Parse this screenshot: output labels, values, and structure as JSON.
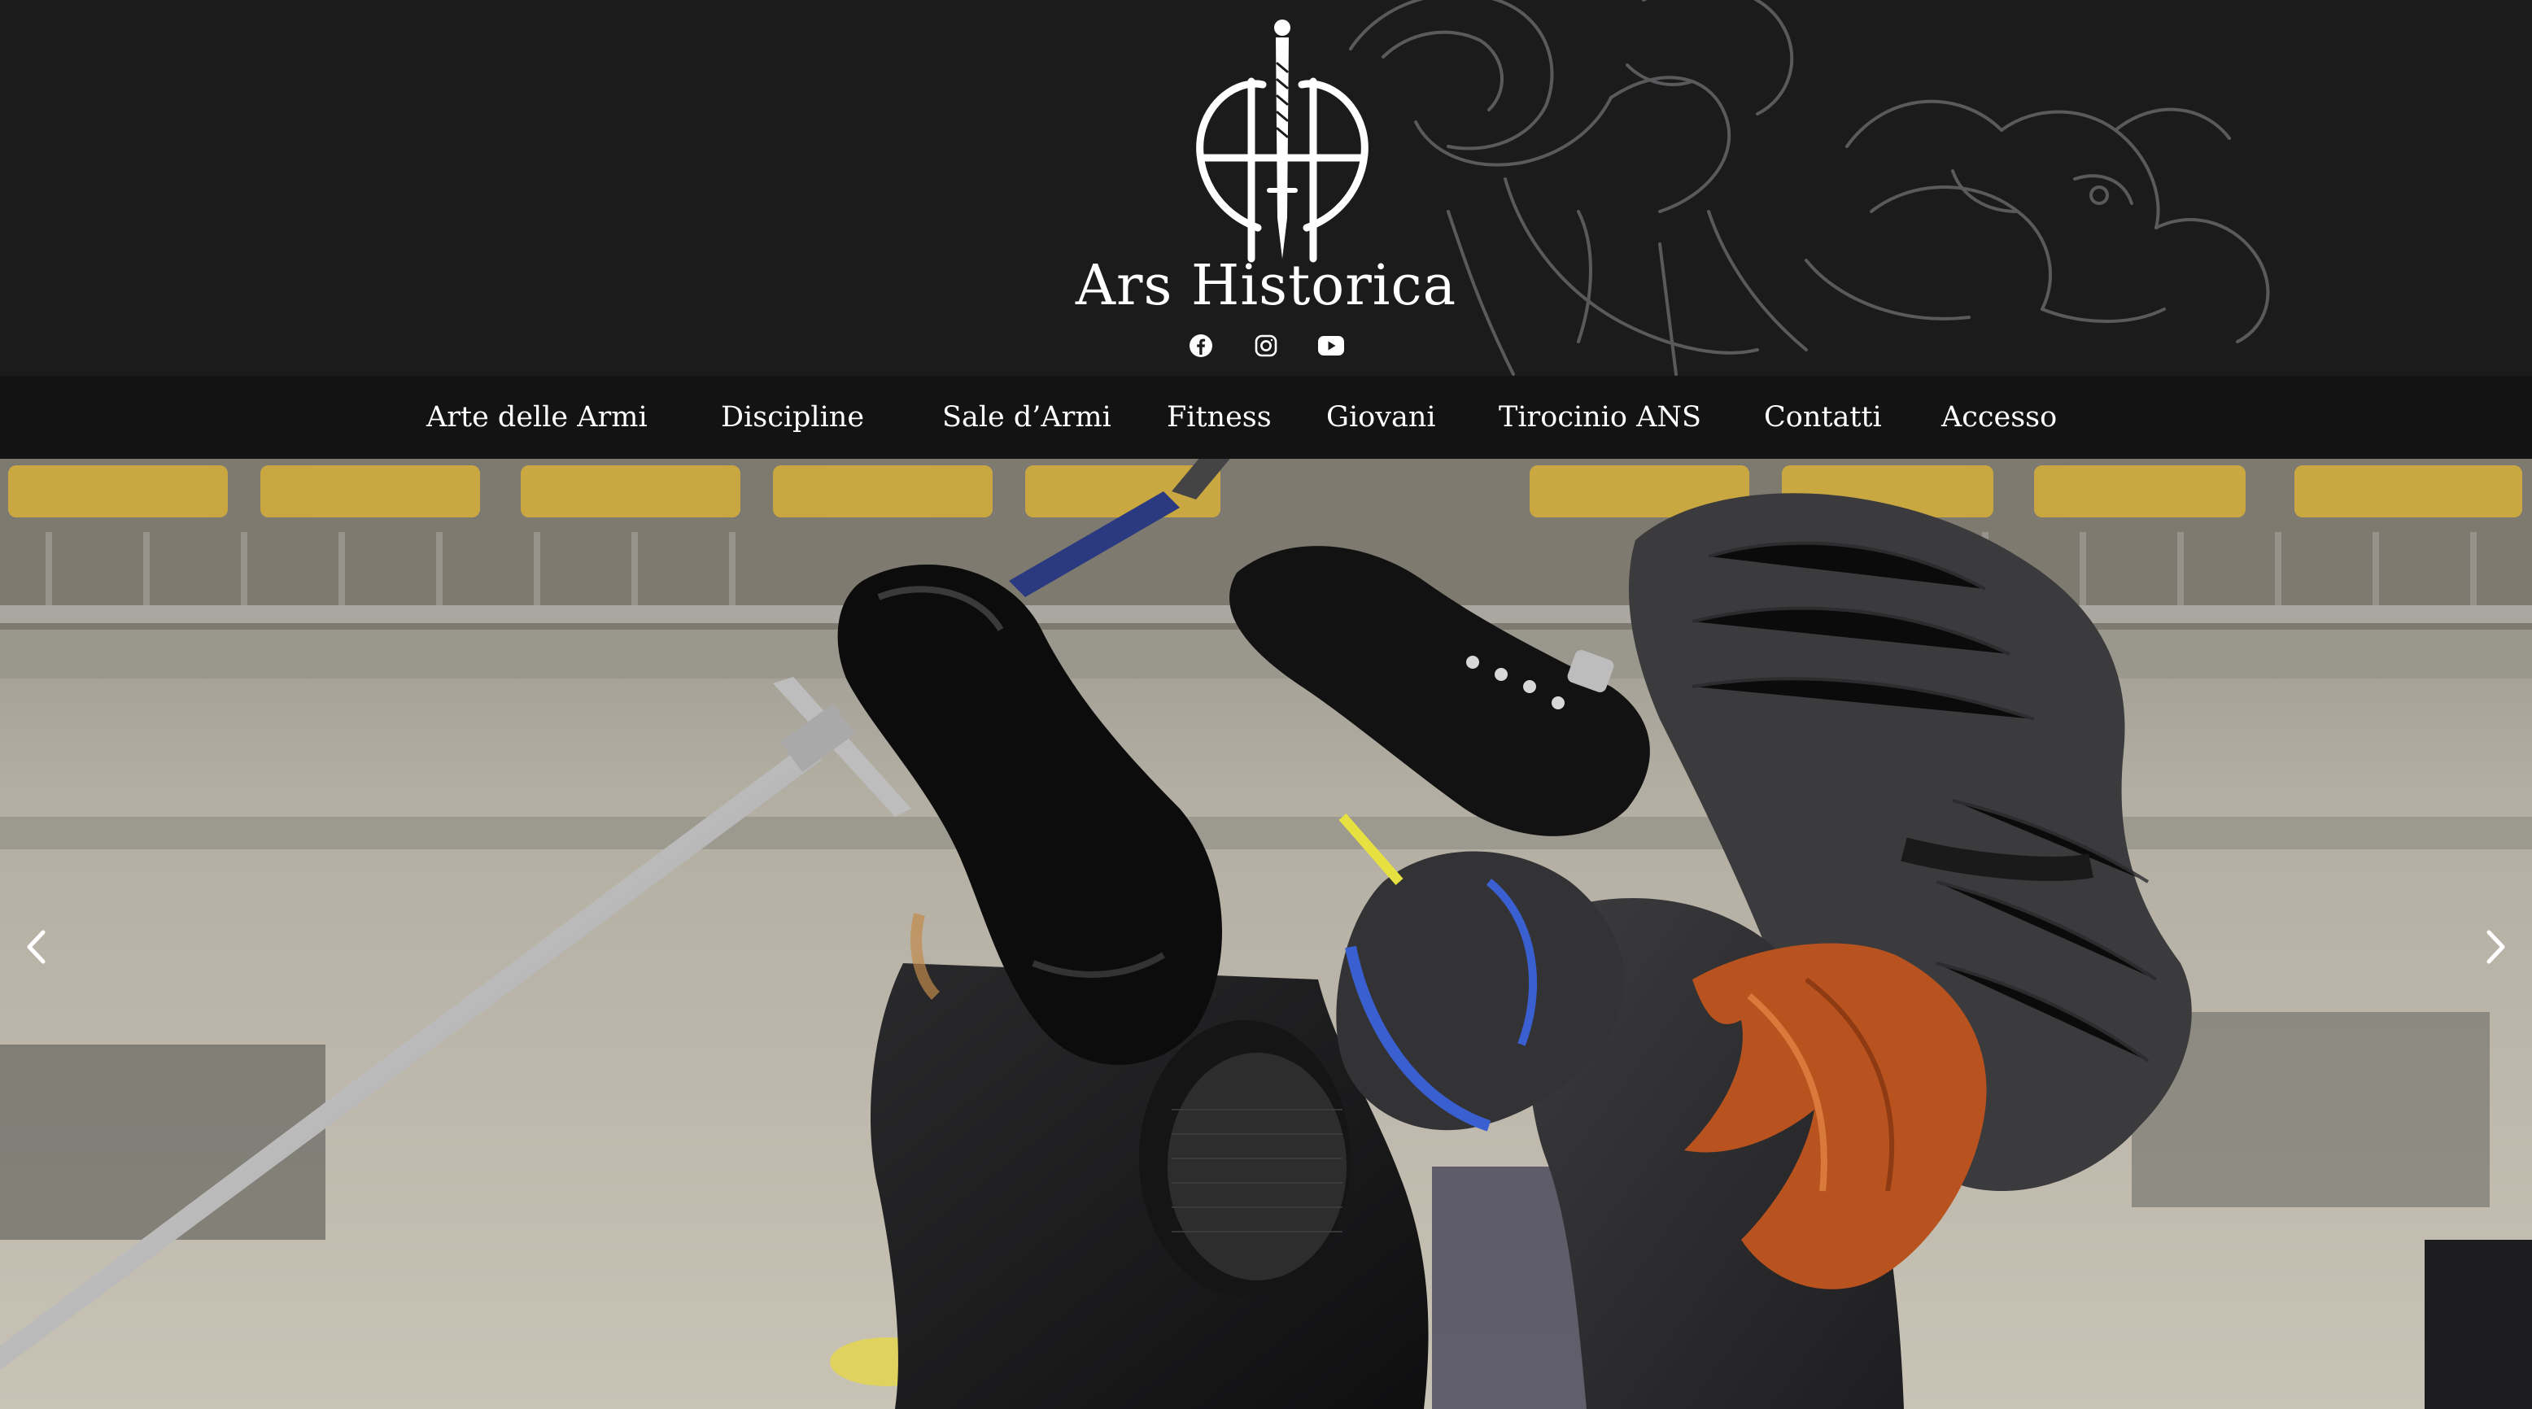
{
  "site": {
    "title": "Ars Historica",
    "logo_icon": "sword-monogram-icon"
  },
  "socials": [
    {
      "name": "facebook",
      "icon": "facebook-icon"
    },
    {
      "name": "instagram",
      "icon": "instagram-icon"
    },
    {
      "name": "youtube",
      "icon": "youtube-icon"
    }
  ],
  "nav": {
    "items": [
      {
        "label": "Arte delle Armi"
      },
      {
        "label": "Discipline"
      },
      {
        "label": "Sale d’Armi"
      },
      {
        "label": "Fitness"
      },
      {
        "label": "Giovani"
      },
      {
        "label": "Tirocinio ANS"
      },
      {
        "label": "Contatti"
      },
      {
        "label": "Accesso"
      }
    ]
  },
  "slider": {
    "prev_icon": "chevron-left-icon",
    "next_icon": "chevron-right-icon",
    "image": "fencers-sparring-photo"
  },
  "colors": {
    "header_bg": "#1b1b1c",
    "nav_bg": "#131313",
    "text": "#ffffff",
    "arena_seats": "#d6b03a"
  }
}
